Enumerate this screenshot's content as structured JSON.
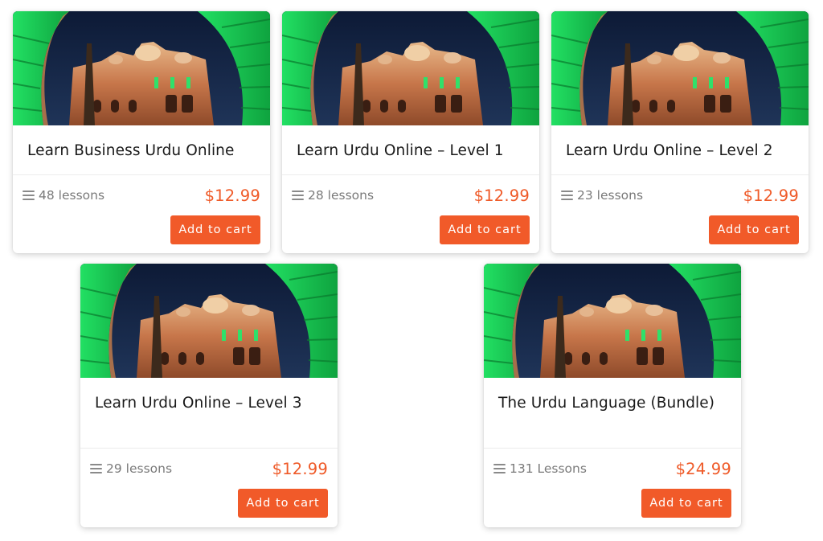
{
  "courses": [
    {
      "title": "Learn Business Urdu Online",
      "lessons": "48 lessons",
      "price": "$12.99",
      "button": "Add to cart"
    },
    {
      "title": "Learn Urdu Online – Level 1",
      "lessons": "28 lessons",
      "price": "$12.99",
      "button": "Add to cart"
    },
    {
      "title": "Learn Urdu Online – Level 2",
      "lessons": "23 lessons",
      "price": "$12.99",
      "button": "Add to cart"
    },
    {
      "title": "Learn Urdu Online – Level 3",
      "lessons": "29 lessons",
      "price": "$12.99",
      "button": "Add to cart"
    },
    {
      "title": "The Urdu Language (Bundle)",
      "lessons": "131 Lessons",
      "price": "$24.99",
      "button": "Add to cart"
    }
  ],
  "icons": {
    "lessons_icon": "list-icon",
    "thumbnail": "lit-palace-through-green-arch"
  },
  "colors": {
    "accent": "#f15a29",
    "price": "#ef5a28",
    "arch_green": "#1fd45a",
    "sky": "#14243f"
  }
}
